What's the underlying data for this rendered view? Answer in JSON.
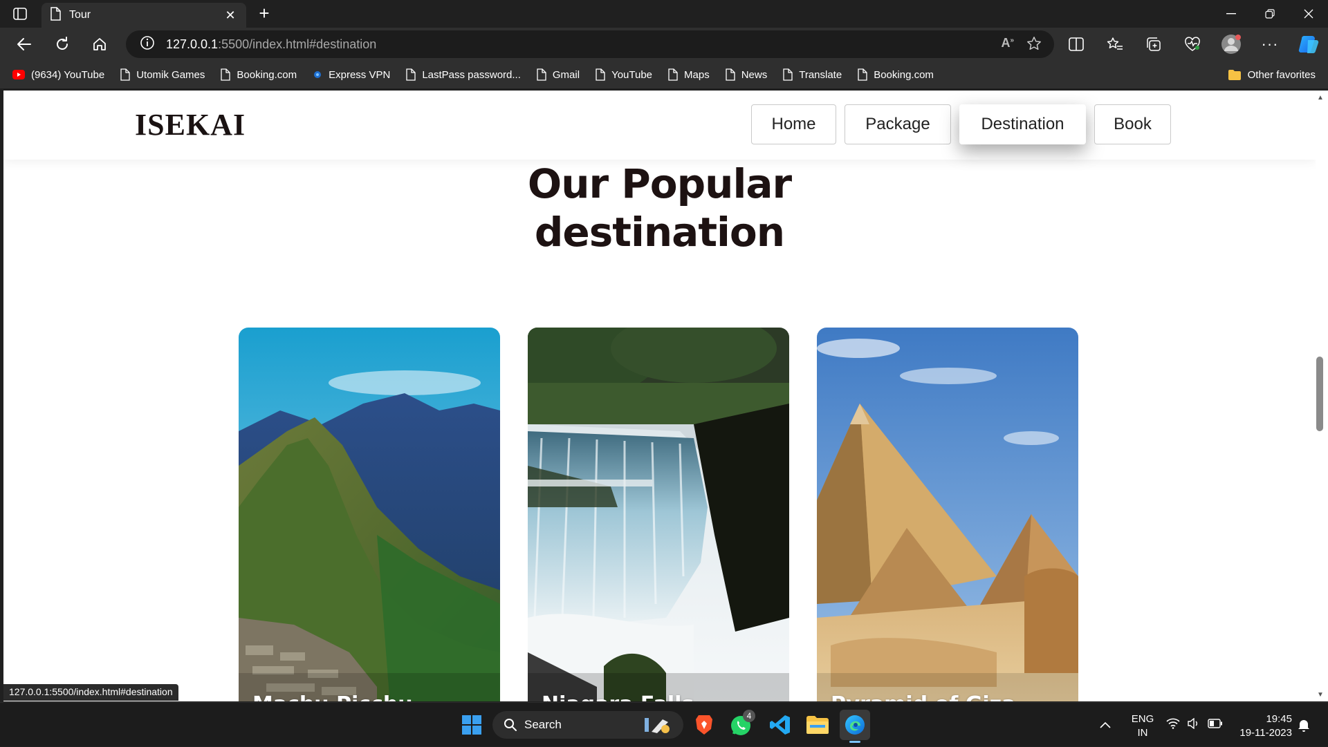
{
  "browser": {
    "tab_title": "Tour",
    "url_host": "127.0.0.1",
    "url_path": ":5500/index.html#destination",
    "favorites": [
      {
        "label": "(9634) YouTube",
        "icon": "youtube-icon"
      },
      {
        "label": "Utomik Games",
        "icon": "page-icon"
      },
      {
        "label": "Booking.com",
        "icon": "page-icon"
      },
      {
        "label": "Express VPN",
        "icon": "vpn-icon"
      },
      {
        "label": "LastPass password...",
        "icon": "page-icon"
      },
      {
        "label": "Gmail",
        "icon": "page-icon"
      },
      {
        "label": "YouTube",
        "icon": "page-icon"
      },
      {
        "label": "Maps",
        "icon": "page-icon"
      },
      {
        "label": "News",
        "icon": "page-icon"
      },
      {
        "label": "Translate",
        "icon": "page-icon"
      },
      {
        "label": "Booking.com",
        "icon": "page-icon"
      }
    ],
    "other_favorites": "Other favorites",
    "status_url": "127.0.0.1:5500/index.html#destination"
  },
  "site": {
    "logo": "ISEKAI",
    "nav": [
      {
        "label": "Home",
        "active": false
      },
      {
        "label": "Package",
        "active": false
      },
      {
        "label": "Destination",
        "active": true
      },
      {
        "label": "Book",
        "active": false
      }
    ],
    "section_title_line1": "Our Popular",
    "section_title_line2": "destination",
    "cards": [
      {
        "label": "Machu Picchu"
      },
      {
        "label": "Niagara Falls"
      },
      {
        "label": "Pyramid of Giza"
      }
    ]
  },
  "taskbar": {
    "search_placeholder": "Search",
    "whatsapp_badge": "4",
    "lang_line1": "ENG",
    "lang_line2": "IN",
    "time": "19:45",
    "date": "19-11-2023"
  },
  "colors": {
    "chrome_dark": "#202020",
    "chrome_toolbar": "#2f2f2f",
    "heading": "#1d1212"
  }
}
